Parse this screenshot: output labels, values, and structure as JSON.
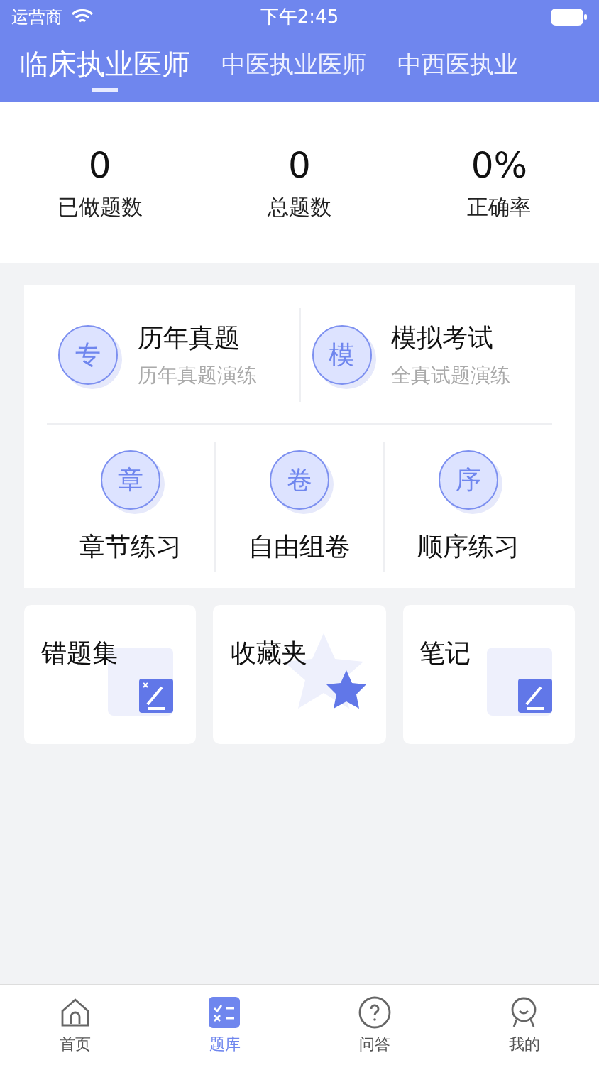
{
  "status_bar": {
    "carrier": "运营商",
    "time": "下午2:45"
  },
  "tabs": [
    {
      "label": "临床执业医师",
      "selected": true
    },
    {
      "label": "中医执业医师",
      "selected": false
    },
    {
      "label": "中西医执业",
      "selected": false
    }
  ],
  "stats": [
    {
      "value": "0",
      "label": "已做题数"
    },
    {
      "value": "0",
      "label": "总题数"
    },
    {
      "value": "0%",
      "label": "正确率"
    }
  ],
  "main_items": [
    {
      "badge": "专",
      "title": "历年真题",
      "subtitle": "历年真题演练"
    },
    {
      "badge": "模",
      "title": "模拟考试",
      "subtitle": "全真试题演练"
    }
  ],
  "practice_items": [
    {
      "badge": "章",
      "title": "章节练习"
    },
    {
      "badge": "卷",
      "title": "自由组卷"
    },
    {
      "badge": "序",
      "title": "顺序练习"
    }
  ],
  "collections": [
    {
      "title": "错题集",
      "kind": "mistakes"
    },
    {
      "title": "收藏夹",
      "kind": "star"
    },
    {
      "title": "笔记",
      "kind": "notes"
    }
  ],
  "bottom_nav": [
    {
      "label": "首页",
      "kind": "home",
      "selected": false
    },
    {
      "label": "题库",
      "kind": "quiz",
      "selected": true
    },
    {
      "label": "问答",
      "kind": "qa",
      "selected": false
    },
    {
      "label": "我的",
      "kind": "me",
      "selected": false
    }
  ]
}
